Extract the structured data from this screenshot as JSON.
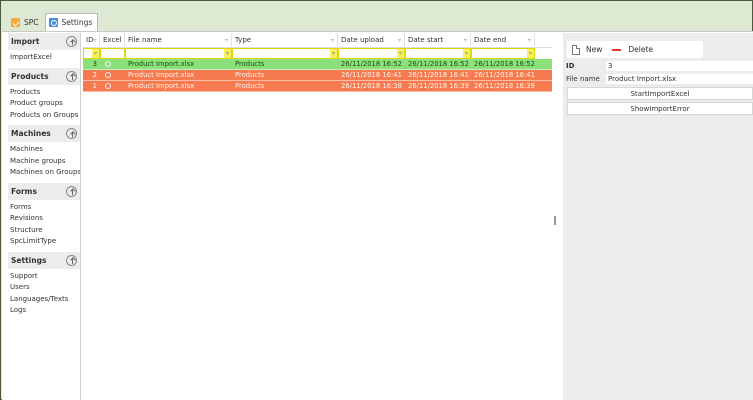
{
  "tabs": [
    {
      "label": "SPC",
      "icon": "spc-app-icon",
      "active": false
    },
    {
      "label": "Settings",
      "icon": "settings-app-icon",
      "active": true
    }
  ],
  "sidebar": {
    "sections": [
      {
        "title": "Import",
        "items": [
          "ImportExcel"
        ]
      },
      {
        "title": "Products",
        "items": [
          "Products",
          "Product groups",
          "Products on Groups"
        ]
      },
      {
        "title": "Machines",
        "items": [
          "Machines",
          "Machine groups",
          "Machines on Groups"
        ]
      },
      {
        "title": "Forms",
        "items": [
          "Forms",
          "Revisions",
          "Structure",
          "SpcLimitType"
        ]
      },
      {
        "title": "Settings",
        "items": [
          "Support",
          "Users",
          "Languages/Texts",
          "Logs"
        ]
      }
    ]
  },
  "grid": {
    "columns": [
      "ID",
      "Excel",
      "File name",
      "Type",
      "Date upload",
      "Date start",
      "Date end"
    ],
    "rows": [
      {
        "id": "3",
        "file": "Product Import.xlsx",
        "type": "Products",
        "upload": "26/11/2018 16:52",
        "start": "26/11/2018 16:52",
        "end": "26/11/2018 16:52",
        "status": "green"
      },
      {
        "id": "2",
        "file": "Product Import.xlsx",
        "type": "Products",
        "upload": "26/11/2018 16:41",
        "start": "26/11/2018 16:41",
        "end": "26/11/2018 16:41",
        "status": "red"
      },
      {
        "id": "1",
        "file": "Product Import.xlsx",
        "type": "Products",
        "upload": "26/11/2018 16:38",
        "start": "26/11/2018 16:39",
        "end": "26/11/2018 16:39",
        "status": "red"
      }
    ]
  },
  "detail": {
    "new_label": "New",
    "delete_label": "Delete",
    "id_label": "ID",
    "id_value": "3",
    "filename_label": "File name",
    "filename_value": "Product Import.xlsx",
    "start_import_label": "StartImportExcel",
    "show_error_label": "ShowImportError"
  },
  "colors": {
    "success_row": "#8be07c",
    "error_row": "#f57a4f",
    "filter_highlight": "#f7f060",
    "delete_accent": "#e03a2a"
  }
}
